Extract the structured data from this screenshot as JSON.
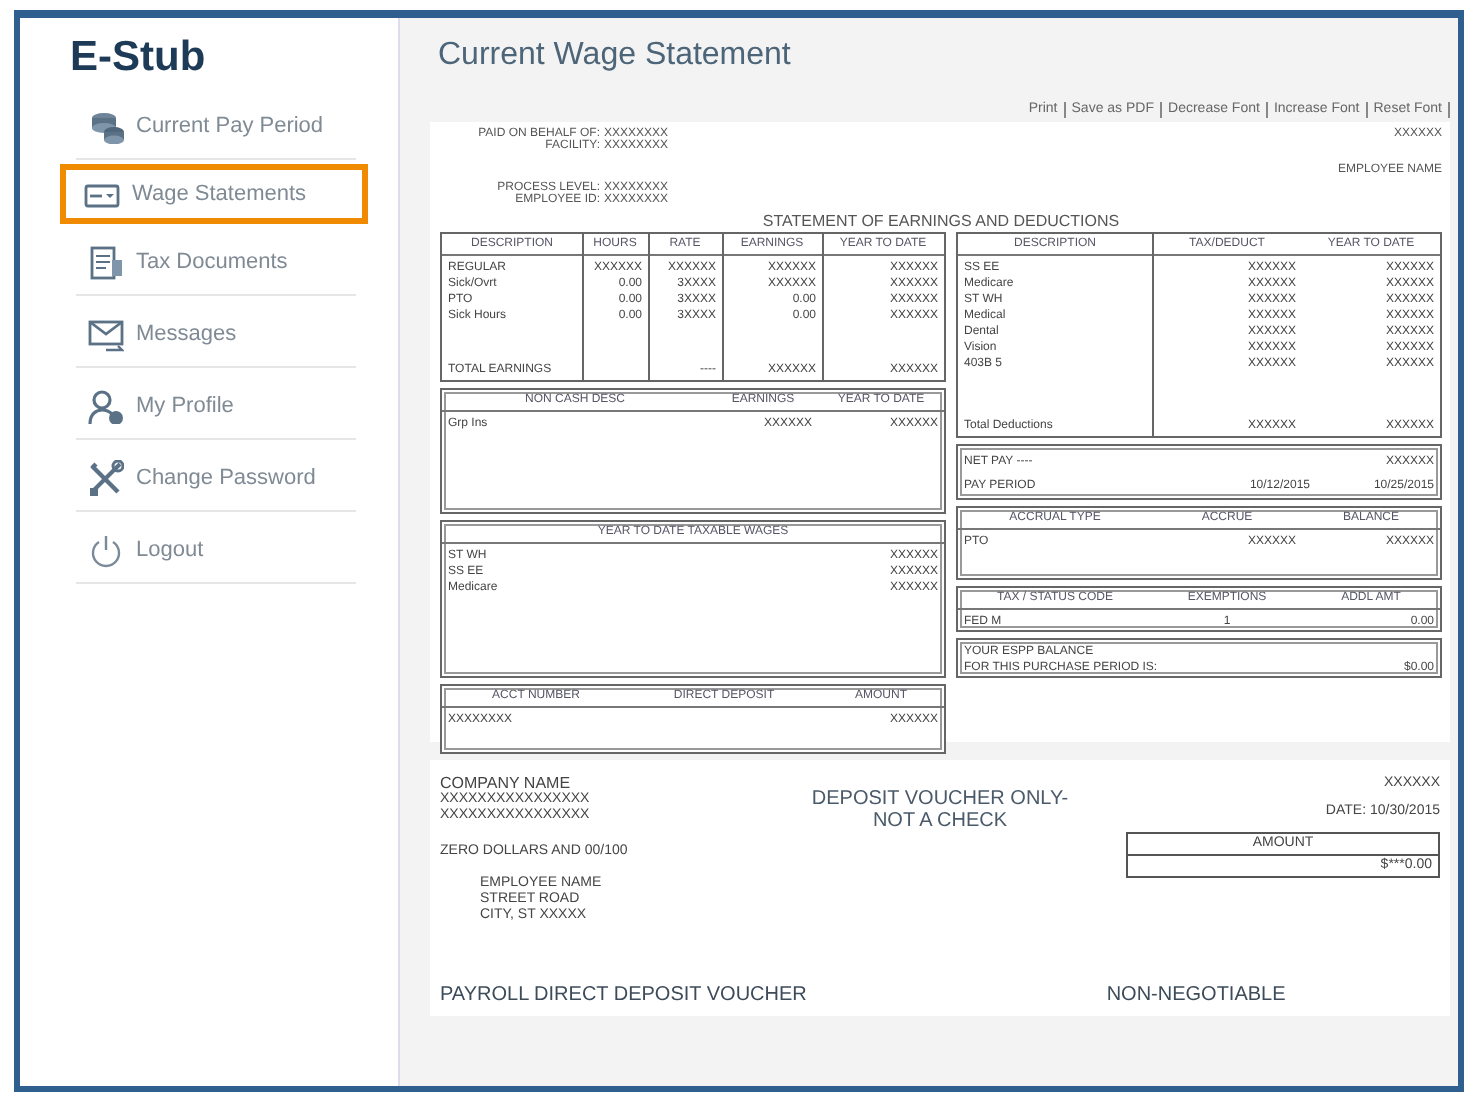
{
  "sidebar": {
    "title": "E-Stub",
    "items": [
      {
        "label": "Current Pay Period",
        "selected": false
      },
      {
        "label": "Wage Statements",
        "selected": true
      },
      {
        "label": "Tax Documents",
        "selected": false
      },
      {
        "label": "Messages",
        "selected": false
      },
      {
        "label": "My Profile",
        "selected": false
      },
      {
        "label": "Change Password",
        "selected": false
      },
      {
        "label": "Logout",
        "selected": false
      }
    ]
  },
  "page_title": "Current Wage Statement",
  "toolbar_links": [
    "Print",
    "Save as PDF",
    "Decrease Font",
    "Increase Font",
    "Reset Font"
  ],
  "statement": {
    "header_left": [
      {
        "label": "PAID ON BEHALF OF:",
        "value": "XXXXXXXX"
      },
      {
        "label": "FACILITY:",
        "value": "XXXXXXXX"
      }
    ],
    "header_left_2": [
      {
        "label": "PROCESS LEVEL:",
        "value": "XXXXXXXX"
      },
      {
        "label": "EMPLOYEE ID:",
        "value": "XXXXXXXX"
      }
    ],
    "check_number": "XXXXXX",
    "employee_name": "EMPLOYEE NAME",
    "title": "STATEMENT OF EARNINGS AND DEDUCTIONS",
    "earnings": {
      "columns": [
        "DESCRIPTION",
        "HOURS",
        "RATE",
        "EARNINGS",
        "YEAR TO DATE"
      ],
      "rows": [
        [
          "REGULAR",
          "XXXXXX",
          "XXXXXX",
          "XXXXXX",
          "XXXXXX"
        ],
        [
          "Sick/Ovrt",
          "0.00",
          "3XXXX",
          "XXXXXX",
          "XXXXXX"
        ],
        [
          "PTO",
          "0.00",
          "3XXXX",
          "0.00",
          "XXXXXX"
        ],
        [
          "Sick Hours",
          "0.00",
          "3XXXX",
          "0.00",
          "XXXXXX"
        ]
      ],
      "total": {
        "description": "TOTAL EARNINGS",
        "rate": "----",
        "earnings": "XXXXXX",
        "year_to_date": "XXXXXX"
      }
    },
    "non_cash": {
      "columns": [
        "NON CASH DESC",
        "EARNINGS",
        "YEAR TO DATE"
      ],
      "rows": [
        [
          "Grp Ins",
          "XXXXXX",
          "XXXXXX"
        ]
      ]
    },
    "taxable_wages": {
      "columns": [
        "YEAR TO DATE TAXABLE WAGES"
      ],
      "rows": [
        [
          "ST WH",
          "XXXXXX"
        ],
        [
          "SS EE",
          "XXXXXX"
        ],
        [
          "Medicare",
          "XXXXXX"
        ]
      ]
    },
    "direct_deposit": {
      "columns": [
        "ACCT NUMBER",
        "DIRECT DEPOSIT",
        "AMOUNT"
      ],
      "rows": [
        {
          "acct_number": "XXXXXXXX",
          "amount": "XXXXXX"
        }
      ]
    },
    "deductions": {
      "columns": [
        "DESCRIPTION",
        "TAX/DEDUCT",
        "YEAR TO DATE"
      ],
      "rows": [
        [
          "SS EE",
          "XXXXXX",
          "XXXXXX"
        ],
        [
          "Medicare",
          "XXXXXX",
          "XXXXXX"
        ],
        [
          "ST WH",
          "XXXXXX",
          "XXXXXX"
        ],
        [
          "Medical",
          "XXXXXX",
          "XXXXXX"
        ],
        [
          "Dental",
          "XXXXXX",
          "XXXXXX"
        ],
        [
          "Vision",
          "XXXXXX",
          "XXXXXX"
        ],
        [
          "403B 5",
          "XXXXXX",
          "XXXXXX"
        ]
      ],
      "total": [
        "Total Deductions",
        "XXXXXX",
        "XXXXXX"
      ]
    },
    "net_pay": {
      "rows": [
        {
          "label": "NET PAY ----",
          "amount": "XXXXXX"
        },
        [
          "PAY PERIOD",
          "10/12/2015",
          "10/25/2015"
        ]
      ]
    },
    "accruals": {
      "columns": [
        "ACCRUAL TYPE",
        "ACCRUE",
        "BALANCE"
      ],
      "rows": [
        [
          "PTO",
          "XXXXXX",
          "XXXXXX"
        ]
      ]
    },
    "tax_status": {
      "columns": [
        "TAX / STATUS CODE",
        "EXEMPTIONS",
        "ADDL AMT"
      ],
      "rows": [
        [
          "FED   M",
          "1",
          "0.00"
        ]
      ]
    },
    "espp": {
      "rows": [
        {
          "label": "YOUR ESPP BALANCE"
        },
        [
          "FOR THIS PURCHASE PERIOD IS:",
          "$0.00"
        ]
      ]
    }
  },
  "voucher": {
    "company_lines": [
      "COMPANY NAME",
      "XXXXXXXXXXXXXXXX",
      "XXXXXXXXXXXXXXXX"
    ],
    "notice_lines": [
      "DEPOSIT VOUCHER ONLY-",
      "NOT A CHECK"
    ],
    "number": "XXXXXX",
    "date": "DATE: 10/30/2015",
    "amount_label": "AMOUNT",
    "amount": "$***0.00",
    "amount_words": "ZERO DOLLARS AND 00/100",
    "address_lines": [
      "EMPLOYEE NAME",
      "STREET ROAD",
      "CITY, ST XXXXX"
    ],
    "footer_left": "PAYROLL DIRECT DEPOSIT VOUCHER",
    "footer_right": "NON-NEGOTIABLE"
  }
}
